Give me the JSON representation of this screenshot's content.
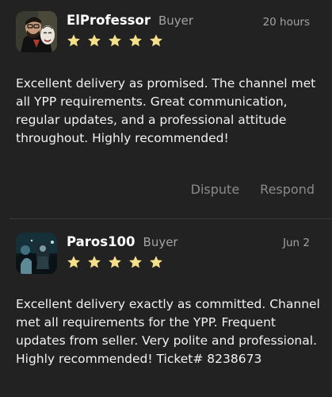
{
  "reviews": [
    {
      "author": "ElProfessor",
      "role": "Buyer",
      "time": "20 hours",
      "rating": 5,
      "text": "Excellent delivery as promised. The channel met all YPP requirements. Great communication, regular updates, and a professional attitude throughout. Highly recommended!",
      "avatar_icon": "masked-man-avatar"
    },
    {
      "author": "Paros100",
      "role": "Buyer",
      "time": "Jun 2",
      "rating": 5,
      "text": "Excellent delivery exactly as committed. Channel met all requirements for the YPP. Frequent updates from seller. Very polite and professional. Highly recommended! Ticket# 8238673",
      "avatar_icon": "dark-scene-avatar"
    }
  ],
  "actions": {
    "dispute_label": "Dispute",
    "respond_label": "Respond"
  },
  "colors": {
    "background": "#222222",
    "star": "#f5e08a",
    "muted_text": "#a3a3a3",
    "action_text": "#8a8a8a"
  }
}
